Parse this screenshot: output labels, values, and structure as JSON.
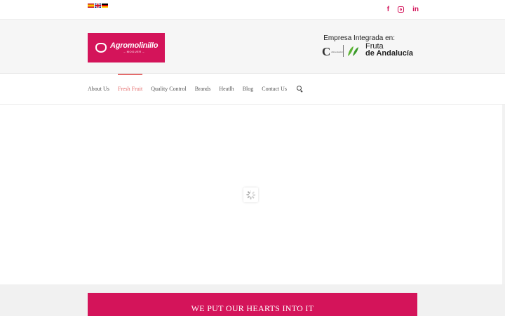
{
  "languages": [
    {
      "code": "es",
      "name": "Español"
    },
    {
      "code": "en",
      "name": "English"
    },
    {
      "code": "de",
      "name": "Deutsch"
    }
  ],
  "social": {
    "facebook": "f",
    "instagram": "instagram-icon",
    "linkedin": "in",
    "color": "#d4145a"
  },
  "logo": {
    "name": "Agromolinillo",
    "subtitle": "– MOGUER –"
  },
  "partner": {
    "heading": "Empresa Integrada en:",
    "badge_letter": "C",
    "badge_small": "Alimentación",
    "name_line1": "Fruta",
    "name_line2": "de Andalucía"
  },
  "nav": {
    "items": [
      {
        "label": "About Us",
        "active": false
      },
      {
        "label": "Fresh Fruit",
        "active": true
      },
      {
        "label": "Quality Control",
        "active": false
      },
      {
        "label": "Brands",
        "active": false
      },
      {
        "label": "Heatlh",
        "active": false
      },
      {
        "label": "Blog",
        "active": false
      },
      {
        "label": "Contact Us",
        "active": false
      }
    ],
    "active_color": "#e46b6b"
  },
  "banner": {
    "text": "WE PUT OUR HEARTS INTO IT",
    "color": "#d4145a"
  }
}
